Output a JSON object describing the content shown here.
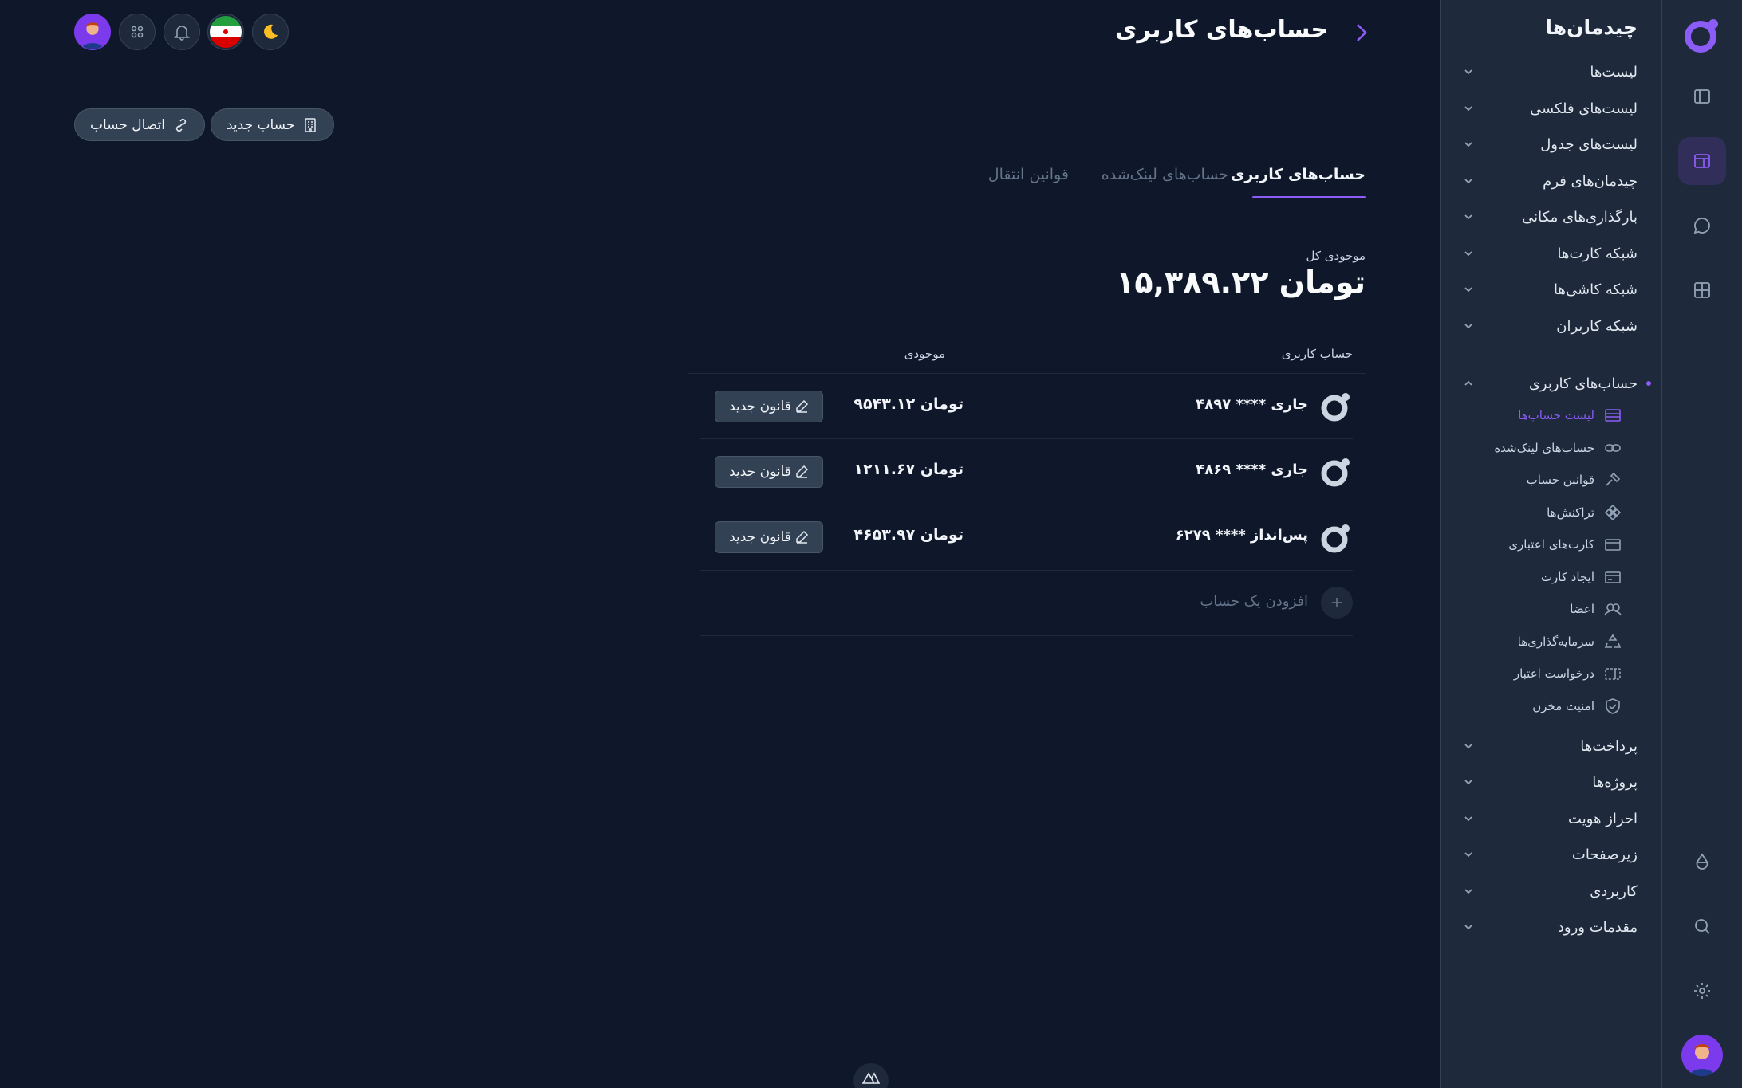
{
  "sidebar": {
    "title": "چیدمان‌ها",
    "items": [
      {
        "label": "لیست‌ها"
      },
      {
        "label": "لیست‌های فلکسی"
      },
      {
        "label": "لیست‌های جدول"
      },
      {
        "label": "چیدمان‌های فرم"
      },
      {
        "label": "بارگذاری‌های مکانی"
      },
      {
        "label": "شبکه کارت‌ها"
      },
      {
        "label": "شبکه کاشی‌ها"
      },
      {
        "label": "شبکه کاربران"
      }
    ],
    "expanded": {
      "label": "حساب‌های کاربری",
      "children": [
        {
          "label": "لیست حساب‌ها",
          "icon": "list-icon",
          "active": true
        },
        {
          "label": "حساب‌های لینک‌شده",
          "icon": "link-icon"
        },
        {
          "label": "قوانین حساب",
          "icon": "gavel-icon"
        },
        {
          "label": "تراکنش‌ها",
          "icon": "diamonds-icon"
        },
        {
          "label": "کارت‌های اعتباری",
          "icon": "credit-card-icon"
        },
        {
          "label": "ایجاد کارت",
          "icon": "card-add-icon"
        },
        {
          "label": "اعضا",
          "icon": "users-icon"
        },
        {
          "label": "سرمایه‌گذاری‌ها",
          "icon": "recycle-icon"
        },
        {
          "label": "درخواست اعتبار",
          "icon": "ticket-icon"
        },
        {
          "label": "امنیت مخزن",
          "icon": "shield-icon"
        }
      ]
    },
    "bottom_items": [
      {
        "label": "پرداخت‌ها"
      },
      {
        "label": "پروژه‌ها"
      },
      {
        "label": "احراز هویت"
      },
      {
        "label": "زیرصفحات"
      },
      {
        "label": "کاربردی"
      },
      {
        "label": "مقدمات ورود"
      }
    ]
  },
  "header": {
    "title": "حساب‌های کاربری"
  },
  "actions": {
    "new_account": "حساب جدید",
    "connect_account": "اتصال حساب"
  },
  "tabs": [
    {
      "label": "حساب‌های کاربری",
      "active": true
    },
    {
      "label": "حساب‌های لینک‌شده"
    },
    {
      "label": "قوانین انتقال"
    }
  ],
  "balance": {
    "label": "موجودی کل",
    "value": "۱۵,۳۸۹.۲۲ تومان"
  },
  "table": {
    "col_account": "حساب کاربری",
    "col_balance": "موجودی",
    "rows": [
      {
        "name": "جاری **** ۴۸۹۷",
        "balance": "۹۵۴۳.۱۲ تومان",
        "action": "قانون جدید"
      },
      {
        "name": "جاری **** ۴۸۶۹",
        "balance": "۱۲۱۱.۶۷ تومان",
        "action": "قانون جدید"
      },
      {
        "name": "پس‌انداز **** ۶۲۷۹",
        "balance": "۴۶۵۳.۹۷ تومان",
        "action": "قانون جدید"
      }
    ],
    "add_label": "افزودن یک حساب"
  },
  "colors": {
    "background": "#0f172a",
    "panel": "#1e293b",
    "accent": "#8b5cf6",
    "moon": "#fbbf24"
  }
}
